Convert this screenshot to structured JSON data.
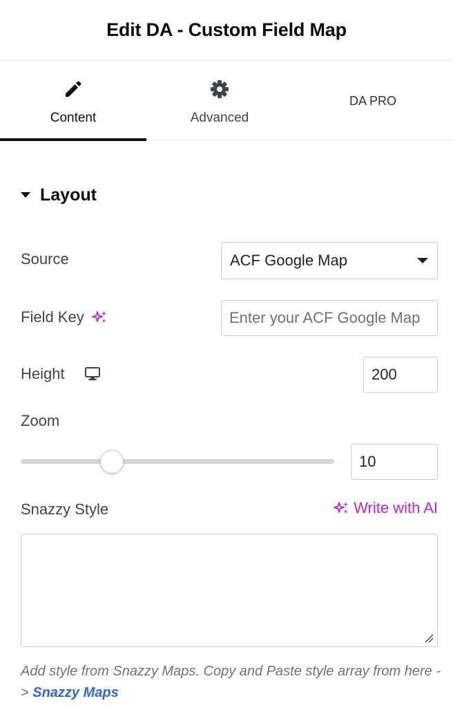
{
  "header": {
    "title": "Edit DA - Custom Field Map"
  },
  "tabs": [
    {
      "label": "Content",
      "icon": "pencil-icon",
      "active": true
    },
    {
      "label": "Advanced",
      "icon": "gear-icon",
      "active": false
    },
    {
      "label": "DA PRO",
      "icon": "",
      "active": false
    }
  ],
  "section": {
    "title": "Layout",
    "icon": "caret-down-icon"
  },
  "fields": {
    "source": {
      "label": "Source",
      "value": "ACF Google Map"
    },
    "field_key": {
      "label": "Field Key",
      "placeholder": "Enter your ACF Google Map",
      "icon": "ai-sparkle-icon"
    },
    "height": {
      "label": "Height",
      "value": "200",
      "icon": "desktop-icon"
    },
    "zoom": {
      "label": "Zoom",
      "value": "10",
      "slider_fraction": 0.29
    },
    "snazzy": {
      "label": "Snazzy Style",
      "ai_label": "Write with AI",
      "value": ""
    }
  },
  "help": {
    "text": "Add style from Snazzy Maps. Copy and Paste style array from here -> ",
    "link_text": "Snazzy Maps"
  },
  "colors": {
    "accent_ai": "#c624c6",
    "link": "#2e66d8",
    "active_tab": "#0c0d0e"
  }
}
